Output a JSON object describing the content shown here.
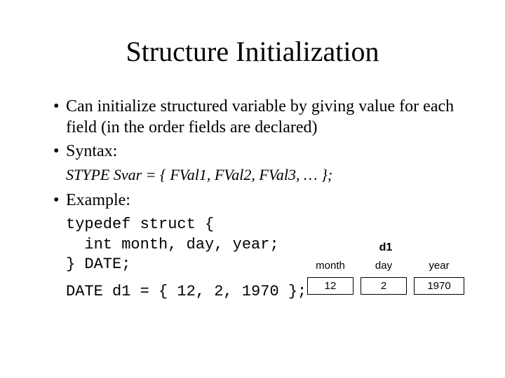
{
  "title": "Structure Initialization",
  "bullets": {
    "b1": "Can initialize structured variable by giving value for each field (in the order fields are declared)",
    "b2": "Syntax:",
    "b3": "Example:"
  },
  "syntax": "STYPE Svar = { FVal1, FVal2, FVal3, … };",
  "code": {
    "typedef_line": "typedef struct {",
    "fields_line": "  int month, day, year;",
    "close_line": "} DATE;",
    "decl_line": "DATE d1 = { 12, 2, 1970 };"
  },
  "diagram": {
    "var_name": "d1",
    "fields": [
      {
        "name": "month",
        "value": "12"
      },
      {
        "name": "day",
        "value": "2"
      },
      {
        "name": "year",
        "value": "1970"
      }
    ]
  }
}
